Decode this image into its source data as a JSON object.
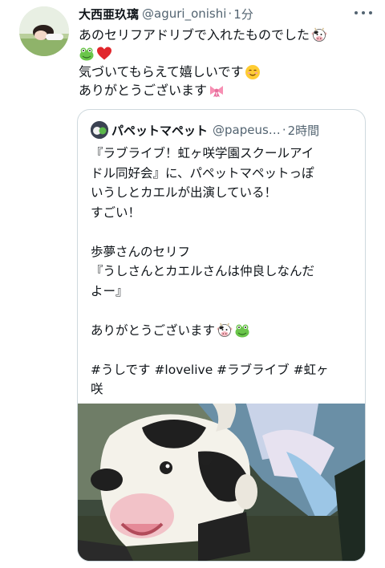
{
  "tweet": {
    "author_name": "大西亜玖璃",
    "author_handle": "@aguri_onishi",
    "separator": "·",
    "time": "1分",
    "lines": [
      "あのセリフアドリブで入れたものでした",
      "",
      "気づいてもらえて嬉しいです",
      "ありがとうございます"
    ]
  },
  "quoted": {
    "author_name": "パペットマペット",
    "author_handle": "@papeus…",
    "separator": "·",
    "time": "2時間",
    "lines": [
      "『ラブライブ！虹ヶ咲学園スクールアイ",
      "ドル同好会』に、パペットマペットっぽ",
      "いうしとカエルが出演している！",
      "すごい！",
      "",
      "歩夢さんのセリフ",
      "『うしさんとカエルさんは仲良しなんだ",
      "よー』",
      "",
      "ありがとうございます",
      "",
      "#うしです #lovelive #ラブライブ #虹ヶ",
      "咲"
    ]
  },
  "icons": {
    "more": "more-dots-icon",
    "cow": "cow-face-icon",
    "frog": "frog-face-icon",
    "heart": "red-heart-icon",
    "smile": "smiling-face-icon",
    "ribbon": "ribbon-icon"
  },
  "colors": {
    "text": "#0f1419",
    "secondary": "#536471",
    "border": "#cfd9de"
  }
}
